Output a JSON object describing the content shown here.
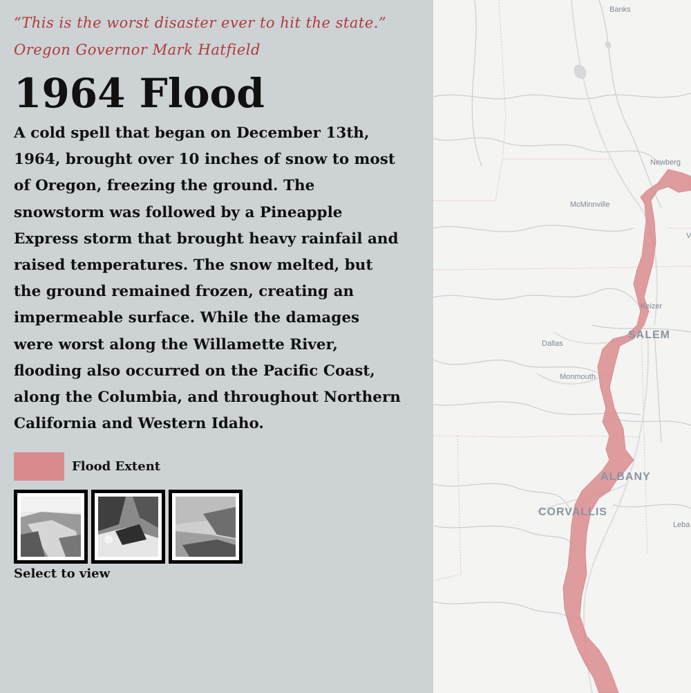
{
  "story": {
    "quote": "“This is the worst disaster ever to hit the state.”",
    "attribution": "Oregon Governor Mark Hatfield",
    "title": "1964 Flood",
    "body": "A cold spell that began on December 13th, 1964, brought over 10 inches of snow to most of Oregon, freezing the ground. The snowstorm was followed by a Pineapple Express storm that brought heavy rainfail and raised temperatures. The snow melted, but the ground remained frozen, creating an impermeable surface. While the damages were worst along the Willamette River, flooding also occurred on the Pacific Coast, along the Columbia, and throughout Northern California and Western Idaho."
  },
  "legend": {
    "label": "Flood Extent",
    "color": "#d98c8e"
  },
  "gallery": {
    "caption": "Select to view",
    "photos": [
      "historic-flood-photo-1",
      "historic-flood-photo-2",
      "historic-flood-photo-3"
    ]
  },
  "map": {
    "places": {
      "banks": "Banks",
      "newberg": "Newberg",
      "mcminnville": "McMinnville",
      "keizer": "Keizer",
      "salem": "SALEM",
      "dallas": "Dallas",
      "monmouth": "Monmouth",
      "albany": "ALBANY",
      "corvallis": "CORVALLIS",
      "lebanon": "Leba",
      "edge_letter": "V"
    },
    "flood_color": "#d98c8e"
  }
}
